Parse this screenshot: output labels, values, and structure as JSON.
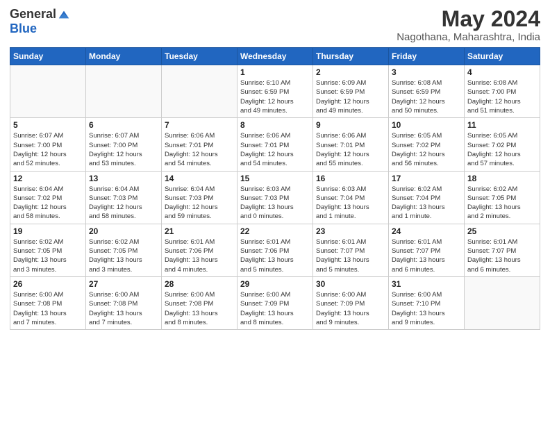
{
  "logo": {
    "general": "General",
    "blue": "Blue"
  },
  "title": "May 2024",
  "subtitle": "Nagothana, Maharashtra, India",
  "days_of_week": [
    "Sunday",
    "Monday",
    "Tuesday",
    "Wednesday",
    "Thursday",
    "Friday",
    "Saturday"
  ],
  "weeks": [
    [
      {
        "day": "",
        "info": ""
      },
      {
        "day": "",
        "info": ""
      },
      {
        "day": "",
        "info": ""
      },
      {
        "day": "1",
        "info": "Sunrise: 6:10 AM\nSunset: 6:59 PM\nDaylight: 12 hours\nand 49 minutes."
      },
      {
        "day": "2",
        "info": "Sunrise: 6:09 AM\nSunset: 6:59 PM\nDaylight: 12 hours\nand 49 minutes."
      },
      {
        "day": "3",
        "info": "Sunrise: 6:08 AM\nSunset: 6:59 PM\nDaylight: 12 hours\nand 50 minutes."
      },
      {
        "day": "4",
        "info": "Sunrise: 6:08 AM\nSunset: 7:00 PM\nDaylight: 12 hours\nand 51 minutes."
      }
    ],
    [
      {
        "day": "5",
        "info": "Sunrise: 6:07 AM\nSunset: 7:00 PM\nDaylight: 12 hours\nand 52 minutes."
      },
      {
        "day": "6",
        "info": "Sunrise: 6:07 AM\nSunset: 7:00 PM\nDaylight: 12 hours\nand 53 minutes."
      },
      {
        "day": "7",
        "info": "Sunrise: 6:06 AM\nSunset: 7:01 PM\nDaylight: 12 hours\nand 54 minutes."
      },
      {
        "day": "8",
        "info": "Sunrise: 6:06 AM\nSunset: 7:01 PM\nDaylight: 12 hours\nand 54 minutes."
      },
      {
        "day": "9",
        "info": "Sunrise: 6:06 AM\nSunset: 7:01 PM\nDaylight: 12 hours\nand 55 minutes."
      },
      {
        "day": "10",
        "info": "Sunrise: 6:05 AM\nSunset: 7:02 PM\nDaylight: 12 hours\nand 56 minutes."
      },
      {
        "day": "11",
        "info": "Sunrise: 6:05 AM\nSunset: 7:02 PM\nDaylight: 12 hours\nand 57 minutes."
      }
    ],
    [
      {
        "day": "12",
        "info": "Sunrise: 6:04 AM\nSunset: 7:02 PM\nDaylight: 12 hours\nand 58 minutes."
      },
      {
        "day": "13",
        "info": "Sunrise: 6:04 AM\nSunset: 7:03 PM\nDaylight: 12 hours\nand 58 minutes."
      },
      {
        "day": "14",
        "info": "Sunrise: 6:04 AM\nSunset: 7:03 PM\nDaylight: 12 hours\nand 59 minutes."
      },
      {
        "day": "15",
        "info": "Sunrise: 6:03 AM\nSunset: 7:03 PM\nDaylight: 13 hours\nand 0 minutes."
      },
      {
        "day": "16",
        "info": "Sunrise: 6:03 AM\nSunset: 7:04 PM\nDaylight: 13 hours\nand 1 minute."
      },
      {
        "day": "17",
        "info": "Sunrise: 6:02 AM\nSunset: 7:04 PM\nDaylight: 13 hours\nand 1 minute."
      },
      {
        "day": "18",
        "info": "Sunrise: 6:02 AM\nSunset: 7:05 PM\nDaylight: 13 hours\nand 2 minutes."
      }
    ],
    [
      {
        "day": "19",
        "info": "Sunrise: 6:02 AM\nSunset: 7:05 PM\nDaylight: 13 hours\nand 3 minutes."
      },
      {
        "day": "20",
        "info": "Sunrise: 6:02 AM\nSunset: 7:05 PM\nDaylight: 13 hours\nand 3 minutes."
      },
      {
        "day": "21",
        "info": "Sunrise: 6:01 AM\nSunset: 7:06 PM\nDaylight: 13 hours\nand 4 minutes."
      },
      {
        "day": "22",
        "info": "Sunrise: 6:01 AM\nSunset: 7:06 PM\nDaylight: 13 hours\nand 5 minutes."
      },
      {
        "day": "23",
        "info": "Sunrise: 6:01 AM\nSunset: 7:07 PM\nDaylight: 13 hours\nand 5 minutes."
      },
      {
        "day": "24",
        "info": "Sunrise: 6:01 AM\nSunset: 7:07 PM\nDaylight: 13 hours\nand 6 minutes."
      },
      {
        "day": "25",
        "info": "Sunrise: 6:01 AM\nSunset: 7:07 PM\nDaylight: 13 hours\nand 6 minutes."
      }
    ],
    [
      {
        "day": "26",
        "info": "Sunrise: 6:00 AM\nSunset: 7:08 PM\nDaylight: 13 hours\nand 7 minutes."
      },
      {
        "day": "27",
        "info": "Sunrise: 6:00 AM\nSunset: 7:08 PM\nDaylight: 13 hours\nand 7 minutes."
      },
      {
        "day": "28",
        "info": "Sunrise: 6:00 AM\nSunset: 7:08 PM\nDaylight: 13 hours\nand 8 minutes."
      },
      {
        "day": "29",
        "info": "Sunrise: 6:00 AM\nSunset: 7:09 PM\nDaylight: 13 hours\nand 8 minutes."
      },
      {
        "day": "30",
        "info": "Sunrise: 6:00 AM\nSunset: 7:09 PM\nDaylight: 13 hours\nand 9 minutes."
      },
      {
        "day": "31",
        "info": "Sunrise: 6:00 AM\nSunset: 7:10 PM\nDaylight: 13 hours\nand 9 minutes."
      },
      {
        "day": "",
        "info": ""
      }
    ]
  ]
}
